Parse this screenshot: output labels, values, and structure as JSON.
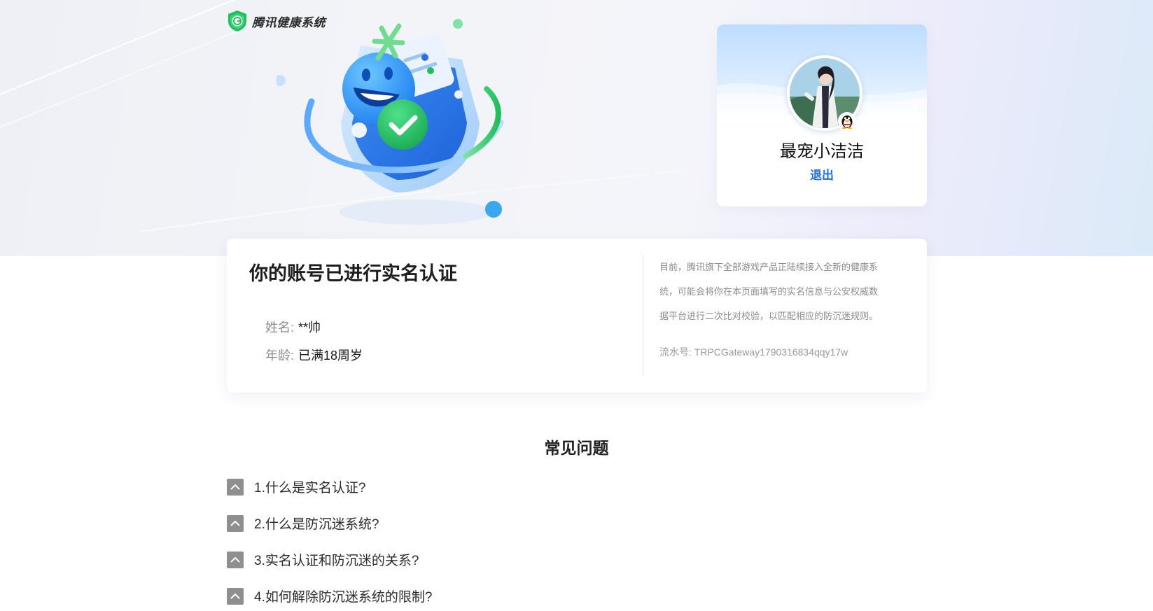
{
  "brand": {
    "name": "腾讯健康系统"
  },
  "user": {
    "nickname": "最宠小洁洁",
    "logout_label": "退出"
  },
  "verification": {
    "title": "你的账号已进行实名认证",
    "name_label": "姓名:",
    "name_value": "**帅",
    "age_label": "年龄:",
    "age_value": "已满18周岁"
  },
  "notice": {
    "lines": [
      "目前，腾讯旗下全部游戏产品正陆续接入全新的健康系",
      "统，可能会将你在本页面填写的实名信息与公安权威数",
      "据平台进行二次比对校验，以匹配相应的防沉迷规则。"
    ],
    "serial": "流水号: TRPCGateway1790316834qqy17w"
  },
  "faq": {
    "title": "常见问题",
    "items": [
      "1.什么是实名认证?",
      "2.什么是防沉迷系统?",
      "3.实名认证和防沉迷的关系?",
      "4.如何解除防沉迷系统的限制?"
    ]
  },
  "colors": {
    "accent": "#1f6fe0",
    "brand_green": "#1fbf5a",
    "toggle_gray": "#8f8f8f"
  },
  "icons": [
    "shield-logo-icon",
    "qq-penguin-icon",
    "chevron-up-icon"
  ]
}
